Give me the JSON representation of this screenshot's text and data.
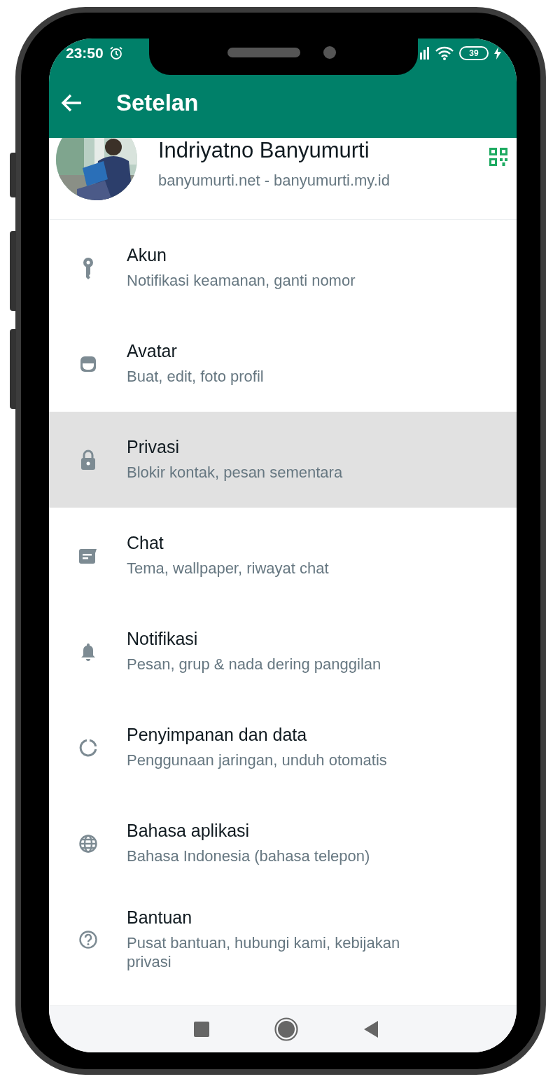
{
  "status_bar": {
    "time": "23:50",
    "battery": "39"
  },
  "app_bar": {
    "title": "Setelan"
  },
  "profile": {
    "name": "Indriyatno Banyumurti",
    "about": "banyumurti.net - banyumurti.my.id"
  },
  "settings": [
    {
      "kind": "key",
      "title": "Akun",
      "subtitle": "Notifikasi keamanan, ganti nomor",
      "selected": false
    },
    {
      "kind": "avatar",
      "title": "Avatar",
      "subtitle": "Buat, edit, foto profil",
      "selected": false
    },
    {
      "kind": "lock",
      "title": "Privasi",
      "subtitle": "Blokir kontak, pesan sementara",
      "selected": true
    },
    {
      "kind": "chat",
      "title": "Chat",
      "subtitle": "Tema, wallpaper, riwayat chat",
      "selected": false
    },
    {
      "kind": "bell",
      "title": "Notifikasi",
      "subtitle": "Pesan, grup & nada dering panggilan",
      "selected": false
    },
    {
      "kind": "storage",
      "title": "Penyimpanan dan data",
      "subtitle": "Penggunaan jaringan, unduh otomatis",
      "selected": false
    },
    {
      "kind": "globe",
      "title": "Bahasa aplikasi",
      "subtitle": "Bahasa Indonesia (bahasa telepon)",
      "selected": false
    },
    {
      "kind": "help",
      "title": "Bantuan",
      "subtitle": "Pusat bantuan, hubungi kami, kebijakan privasi",
      "selected": false
    }
  ]
}
